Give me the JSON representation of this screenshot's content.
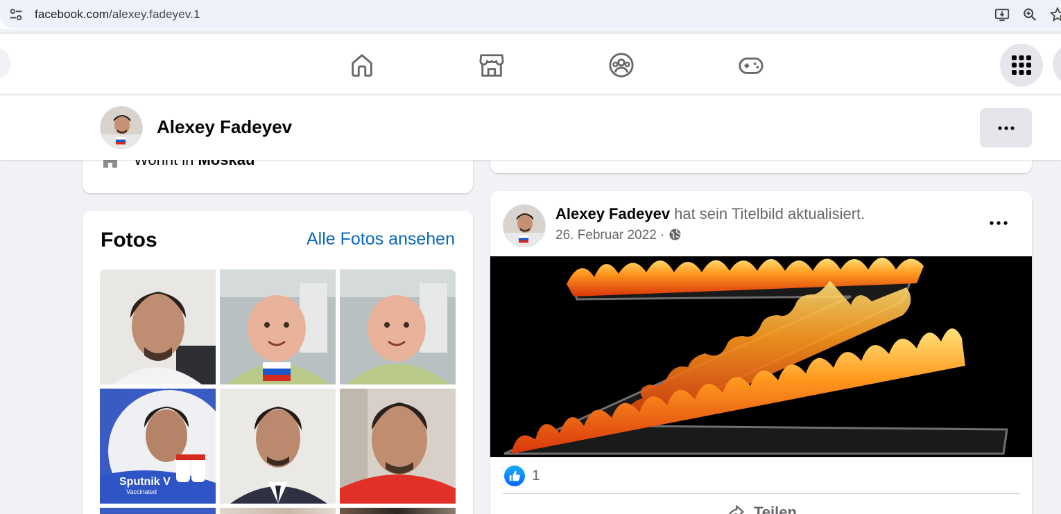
{
  "browser": {
    "url_host": "facebook.com",
    "url_path": "/alexey.fadeyev.1",
    "icons": [
      "site-controls-icon",
      "install-app-icon",
      "zoom-icon",
      "bookmark-star-icon"
    ]
  },
  "nav": {
    "icons": [
      "home-icon",
      "marketplace-icon",
      "groups-icon",
      "gaming-icon",
      "menu-grid-icon"
    ]
  },
  "profile_header": {
    "name": "Alexey Fadeyev",
    "more_label": "···"
  },
  "intro": {
    "lives_prefix": "Wohnt in",
    "lives_city": "Moskau"
  },
  "photos": {
    "title": "Fotos",
    "see_all": "Alle Fotos ansehen",
    "tile_texts": {
      "sputnik": "Sputnik V",
      "sputnik_sub": "Vaccinated"
    }
  },
  "post": {
    "author": "Alexey Fadeyev",
    "action": "hat sein Titelbild aktualisiert.",
    "date": "26. Februar 2022",
    "separator": "·",
    "reaction_count": "1",
    "share_label": "Teilen",
    "audience_icon": "globe-icon"
  },
  "colors": {
    "link_blue": "#0a66c2",
    "like_blue": "#0866ff",
    "page_bg": "#f0f2f5"
  }
}
